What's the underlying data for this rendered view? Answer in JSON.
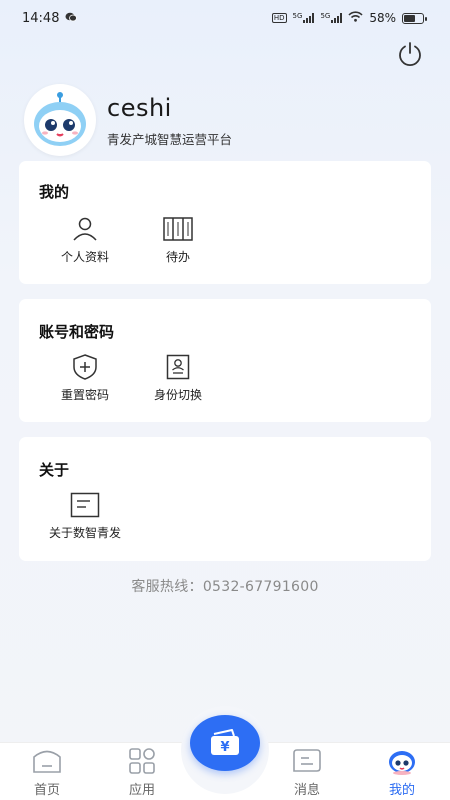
{
  "status_bar": {
    "time": "14:48",
    "battery": "58%",
    "hd_label": "HD",
    "net1": "5G",
    "net2": "5G",
    "battery_level": 0.58
  },
  "profile": {
    "name": "ceshi",
    "platform": "青发产城智慧运营平台"
  },
  "sections": {
    "mine": {
      "title": "我的",
      "items": [
        {
          "label": "个人资料",
          "icon": "person-icon"
        },
        {
          "label": "待办",
          "icon": "todo-icon"
        }
      ]
    },
    "account": {
      "title": "账号和密码",
      "items": [
        {
          "label": "重置密码",
          "icon": "shield-plus-icon"
        },
        {
          "label": "身份切换",
          "icon": "id-card-icon"
        }
      ]
    },
    "about": {
      "title": "关于",
      "items": [
        {
          "label": "关于数智青发",
          "icon": "document-icon"
        }
      ]
    }
  },
  "hotline": "客服热线：0532-67791600",
  "bottom_nav": {
    "items": [
      {
        "label": "首页",
        "icon": "home-icon"
      },
      {
        "label": "应用",
        "icon": "apps-grid-icon"
      },
      {
        "label": "消息",
        "icon": "message-icon"
      },
      {
        "label": "我的",
        "icon": "robot-avatar-icon",
        "active": true
      }
    ],
    "center_icon": "wallet-yen-icon"
  },
  "colors": {
    "accent": "#2d6ef4",
    "active_text": "#2a6bf2"
  }
}
